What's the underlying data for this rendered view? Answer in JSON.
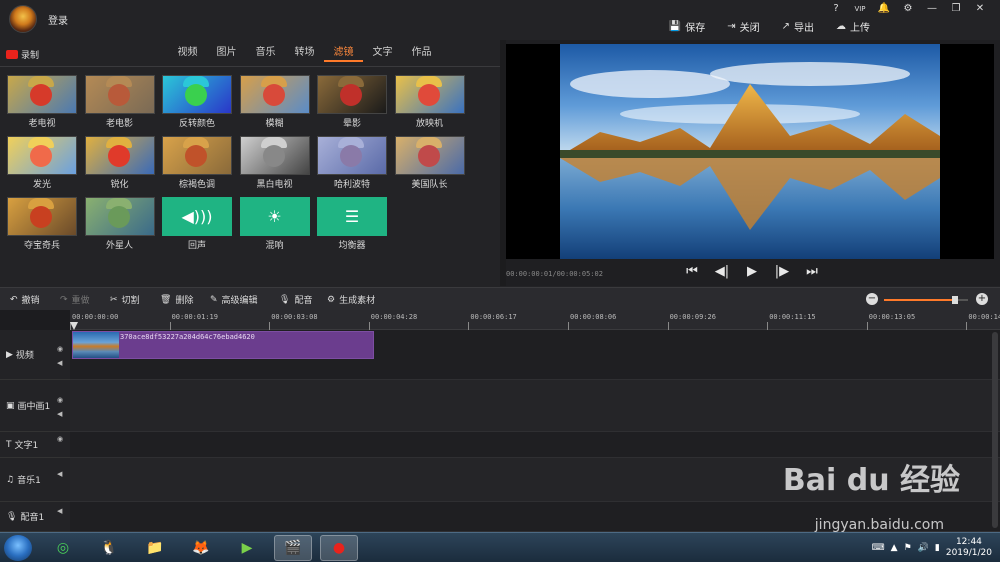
{
  "titlebar": {
    "login_label": "登录",
    "window_buttons": [
      "?",
      "VIP",
      "🔔",
      "⚙",
      "—",
      "❐",
      "✕"
    ]
  },
  "top_actions": [
    {
      "icon": "save-icon",
      "label": "保存"
    },
    {
      "icon": "close-doc-icon",
      "label": "关闭"
    },
    {
      "icon": "export-icon",
      "label": "导出"
    },
    {
      "icon": "upload-icon",
      "label": "上传"
    }
  ],
  "left_panel": {
    "record_label": "录制",
    "tabs": [
      "视频",
      "图片",
      "音乐",
      "转场",
      "滤镜",
      "文字",
      "作品"
    ],
    "active_tab": "滤镜",
    "filters": [
      {
        "label": "老电视",
        "tone": [
          "#c8a84a",
          "#d63a2a",
          "#4b79b2"
        ]
      },
      {
        "label": "老电影",
        "tone": [
          "#b48a55",
          "#b85a3a",
          "#7a6a55"
        ]
      },
      {
        "label": "反转颜色",
        "tone": [
          "#2bc7d8",
          "#3ad04e",
          "#2a36c9"
        ]
      },
      {
        "label": "模糊",
        "tone": [
          "#d79f4a",
          "#d84a3a",
          "#5a8cc8"
        ]
      },
      {
        "label": "晕影",
        "tone": [
          "#8a6a3a",
          "#c0302a",
          "#1a1a1a"
        ]
      },
      {
        "label": "放映机",
        "tone": [
          "#e8c04a",
          "#e04a3a",
          "#3a72c0"
        ]
      },
      {
        "label": "发光",
        "tone": [
          "#f0d05a",
          "#f06a4a",
          "#6aa0e0"
        ]
      },
      {
        "label": "锐化",
        "tone": [
          "#e0b040",
          "#e03a2a",
          "#3a6ab8"
        ]
      },
      {
        "label": "棕褐色调",
        "tone": [
          "#d8a24a",
          "#c0522a",
          "#8a6a3a"
        ]
      },
      {
        "label": "黑白电视",
        "tone": [
          "#cfcfcf",
          "#888888",
          "#444444"
        ]
      },
      {
        "label": "哈利波特",
        "tone": [
          "#a8b0d8",
          "#8a7aa8",
          "#5a6aa8"
        ]
      },
      {
        "label": "美国队长",
        "tone": [
          "#d8b06a",
          "#c04a4a",
          "#4a6aa8"
        ]
      },
      {
        "label": "夺宝奇兵",
        "tone": [
          "#d8a040",
          "#c84020",
          "#6a4a2a"
        ]
      },
      {
        "label": "外星人",
        "tone": [
          "#8ab070",
          "#6a9a5a",
          "#3a6a8a"
        ]
      }
    ],
    "audio_filters": [
      {
        "label": "回声",
        "icon": "echo-icon",
        "glyph": "◀)))"
      },
      {
        "label": "混响",
        "icon": "reverb-icon",
        "glyph": "☀"
      },
      {
        "label": "均衡器",
        "icon": "equalizer-icon",
        "glyph": "☰"
      }
    ]
  },
  "preview": {
    "time_readout": "00:00:00:01/00:00:05:02",
    "controls": [
      {
        "icon": "skip-start-icon",
        "glyph": "⏮"
      },
      {
        "icon": "step-back-icon",
        "glyph": "◀|"
      },
      {
        "icon": "play-icon",
        "glyph": "▶"
      },
      {
        "icon": "step-forward-icon",
        "glyph": "|▶"
      },
      {
        "icon": "skip-end-icon",
        "glyph": "⏭"
      }
    ]
  },
  "edit_toolbar": {
    "tools": [
      {
        "icon": "undo-icon",
        "label": "撤销",
        "enabled": true
      },
      {
        "icon": "redo-icon",
        "label": "重做",
        "enabled": false
      },
      {
        "icon": "scissors-icon",
        "label": "切割",
        "enabled": true
      },
      {
        "icon": "trash-icon",
        "label": "删除",
        "enabled": true
      },
      {
        "icon": "pen-icon",
        "label": "高级编辑",
        "enabled": true
      },
      {
        "icon": "mic-icon",
        "label": "配音",
        "enabled": true
      },
      {
        "icon": "film-reel-icon",
        "label": "生成素材",
        "enabled": true
      }
    ],
    "zoom_level": 0.85
  },
  "timeline": {
    "ruler_labels": [
      "00:00:00:00",
      "00:00:01:19",
      "00:00:03:08",
      "00:00:04:28",
      "00:00:06:17",
      "00:00:08:06",
      "00:00:09:26",
      "00:00:11:15",
      "00:00:13:05",
      "00:00:14:"
    ],
    "tracks": [
      {
        "icon": "video-icon",
        "glyph": "▶",
        "label": "视频"
      },
      {
        "icon": "pip-icon",
        "glyph": "▣",
        "label": "画中画1"
      },
      {
        "icon": "text-icon",
        "glyph": "T",
        "label": "文字1"
      },
      {
        "icon": "music-icon",
        "glyph": "♫",
        "label": "音乐1"
      },
      {
        "icon": "mic-icon",
        "glyph": "🎙",
        "label": "配音1"
      }
    ],
    "clip_name": "370ace8df53227a204d64c76ebad4620"
  },
  "taskbar": {
    "apps": [
      "360-browser-icon",
      "qq-icon",
      "file-explorer-icon",
      "firefox-icon",
      "media-player-icon",
      "video-editor-icon",
      "screen-recorder-icon"
    ],
    "time": "12:44",
    "date": "2019/1/20"
  },
  "watermark": {
    "brand": "Bai du 经验",
    "url": "jingyan.baidu.com"
  }
}
